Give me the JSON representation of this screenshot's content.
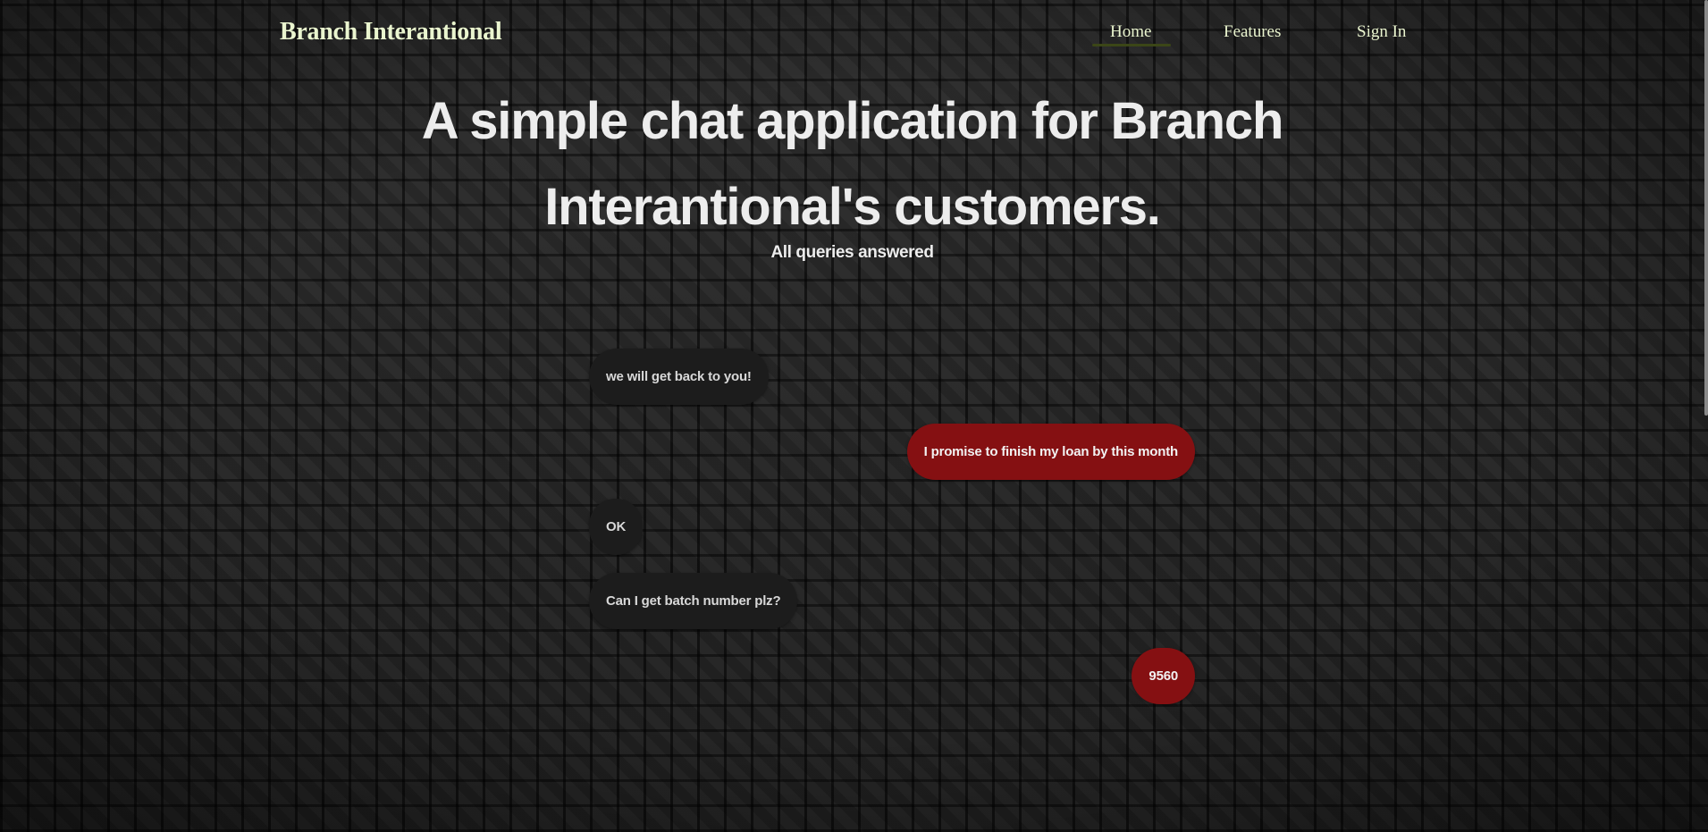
{
  "brand": {
    "name": "Branch Interantional"
  },
  "nav": {
    "items": [
      {
        "label": "Home",
        "active": true
      },
      {
        "label": "Features",
        "active": false
      },
      {
        "label": "Sign In",
        "active": false
      }
    ]
  },
  "hero": {
    "title": "A simple chat application for Branch Interantional's customers.",
    "subtitle": "All queries answered"
  },
  "chat": {
    "messages": [
      {
        "direction": "incoming",
        "text": "we will get back to you!"
      },
      {
        "direction": "outgoing",
        "text": "I promise to finish my loan by this month"
      },
      {
        "direction": "incoming",
        "text": "OK"
      },
      {
        "direction": "incoming",
        "text": "Can I get batch number plz?"
      },
      {
        "direction": "outgoing",
        "text": "9560"
      }
    ]
  },
  "colors": {
    "accent_text": "#eaf5cf",
    "outgoing_bubble": "#851012",
    "incoming_bubble": "#1c1c1c",
    "background": "#262626"
  }
}
